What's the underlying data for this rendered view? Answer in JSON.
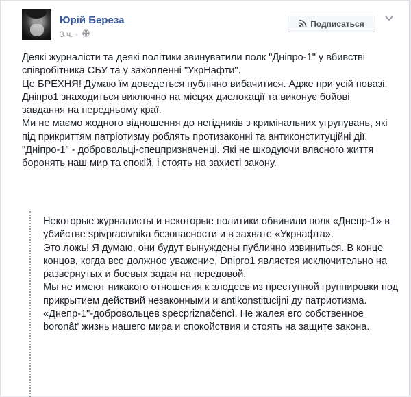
{
  "author": {
    "name": "Юрій Береза",
    "time": "3 ч.",
    "privacy_icon": "globe-icon"
  },
  "actions": {
    "subscribe_label": "Подписаться",
    "subscribe_icon": "rss-icon",
    "menu_icon": "chevron-down-icon"
  },
  "post": {
    "paragraphs": [
      "Деякі журналісти та деякі політики звинуватили полк \"Дніпро-1\" у вбивстві співробітника СБУ та у захопленні \"УкрНафти\".",
      "Це БРЕХНЯ! Думаю їм доведеться публічно вибачитися. Адже при усій повазі, Дніпро1 знаходиться виключно на місцях дислокації та виконує бойові завдання на передньому краї.",
      "Ми не маємо жодного відношення до негідників з кримінальних угрупувань, які під прикриттям патріотизму роблять протизаконні та антиконституційні дії.",
      "\"Дніпро-1\" - добровольці-спецпризначенці. Які не шкодуючи власного життя боронять наш мир та спокій, і стоять на захисті закону."
    ]
  },
  "translation": {
    "paragraphs": [
      "Некоторые журналисты и некоторые политики обвинили полк «Днепр-1» в убийстве spivpracivnika безопасности и в захвате «Укрнафта».",
      "Это ложь! Я думаю, они будут вынуждены публично извиниться. В конце концов, когда все должное уважение, Dnipro1 является исключительно на развернутых и боевых задач на передовой.",
      "Мы не имеют никакого отношения к злодеев из преступной группировки под прикрытием действий незаконными и antikonstitucijni ду патриотизма.",
      "«Днепр-1\"-добровольцев specpriznačencì. Не жалея его собственное boronât' жизнь нашего мира и спокойствия и стоять на защите закона."
    ]
  },
  "colors": {
    "name_link": "#365899",
    "meta_text": "#90949c",
    "body_text": "#1d2129",
    "card_bg": "#ffffff",
    "page_bg": "#e9ebee"
  }
}
